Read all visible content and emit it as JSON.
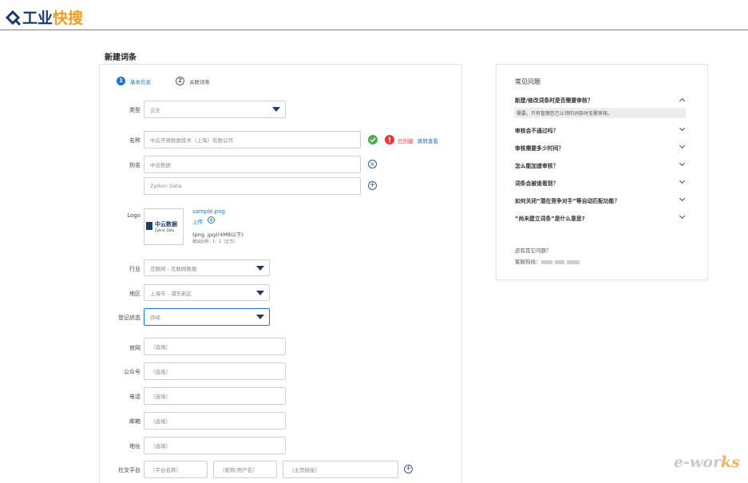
{
  "header": {
    "brand_part1": "工业",
    "brand_part2": "快搜"
  },
  "page_title": "新建词条",
  "steps": [
    {
      "num": "1",
      "label": "基本信息"
    },
    {
      "num": "2",
      "label": "关联词条"
    }
  ],
  "form": {
    "type": {
      "label": "类型",
      "value": "企业"
    },
    "name": {
      "label": "名称",
      "value": "中云开源数据技术（上海）有限公司",
      "created_text": "已创建",
      "jump_link": "跳转查看"
    },
    "alias": {
      "label": "别名",
      "values": [
        "中云数据",
        "Zyllion Data"
      ]
    },
    "logo": {
      "label": "Logo",
      "filename": "sample.png",
      "upload_label": "上传",
      "format_hint": "(png, jpg)(4MB以下)",
      "ratio_hint": "建议比例：1：1（正方）",
      "image_text_main": "中云数据",
      "image_text_sub": "Zyllion Data"
    },
    "industry": {
      "label": "行业",
      "value": "互联网 - 互联网数据"
    },
    "region": {
      "label": "地区",
      "value": "上海市 - 浦东新区"
    },
    "reg_status": {
      "label": "登记状态",
      "value": "存续"
    },
    "website": {
      "label": "官网",
      "placeholder": "（选填）"
    },
    "wechat": {
      "label": "公众号",
      "placeholder": "（选填）"
    },
    "phone": {
      "label": "电话",
      "placeholder": "（选填）"
    },
    "email": {
      "label": "邮箱",
      "placeholder": "（选填）"
    },
    "address": {
      "label": "地址",
      "placeholder": "（选填）"
    },
    "social": {
      "label": "社交平台",
      "platform_placeholder": "（平台名称）",
      "nickname_placeholder": "（昵称/用户名）",
      "homepage_placeholder": "（主页链接）"
    }
  },
  "faq": {
    "title": "常见问题",
    "items": [
      {
        "q": "新建/修改词条时是否需要审核？",
        "a": "需要。只有管理您已认领的词条时无需审核。",
        "expanded": true
      },
      {
        "q": "审核会不通过吗？"
      },
      {
        "q": "审核需要多少时间？"
      },
      {
        "q": "怎么能加速审核？"
      },
      {
        "q": "词条会被谁看到？"
      },
      {
        "q": "如何关闭“潜在竞争对手”等自动匹配功能？"
      },
      {
        "q": "“尚未建立词条”是什么意思?"
      }
    ],
    "more_text": "还有其它问题？",
    "hotline_label": "客服热线："
  },
  "watermark": {
    "part1": "e-wor",
    "part2": "ks"
  },
  "colors": {
    "accent": "#1976d2",
    "brand_dark": "#17396b",
    "brand_orange": "#f29b1d",
    "success": "#4caf50",
    "danger": "#e53935"
  }
}
